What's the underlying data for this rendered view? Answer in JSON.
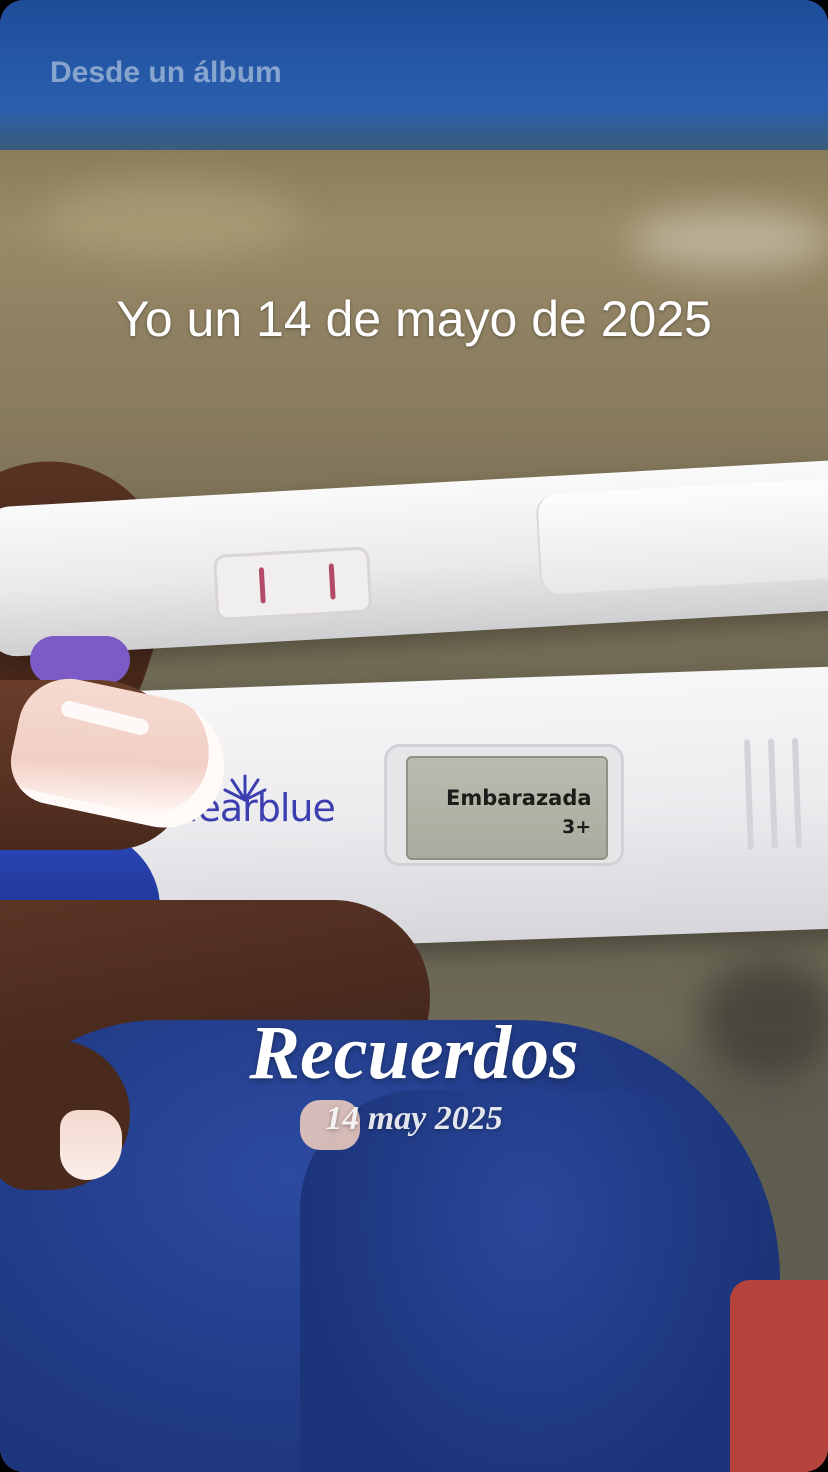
{
  "story": {
    "source_label": "Desde un álbum",
    "caption": "Yo un 14 de mayo de 2025",
    "memories_title": "Recuerdos",
    "memories_date": "14 may 2025"
  },
  "photo": {
    "brand_text": "clearblue",
    "display_line1": "Embarazada",
    "display_line2": "3+"
  },
  "colors": {
    "wall_blue": "#2458a4",
    "jeans_blue": "#213b86",
    "brand_purple": "#3d3fb0",
    "test_line": "#b34a6a",
    "lcd_green": "#b9bcae"
  }
}
